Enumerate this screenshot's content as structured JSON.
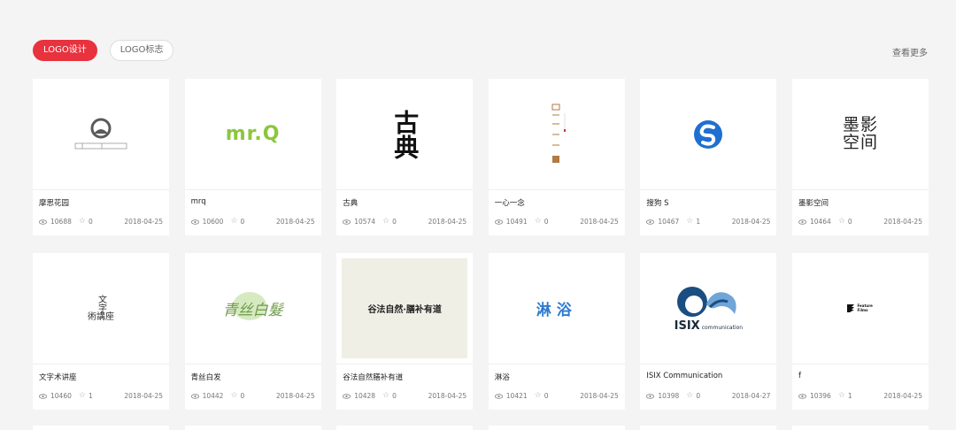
{
  "tabs": [
    {
      "label": "LOGO设计",
      "active": true
    },
    {
      "label": "LOGO标志",
      "active": false
    }
  ],
  "more_label": "查看更多",
  "items": [
    {
      "title": "摩思花园",
      "views": "10688",
      "stars": "0",
      "date": "2018-04-25",
      "logo_icon": "moso-garden-logo"
    },
    {
      "title": "mrq",
      "views": "10600",
      "stars": "0",
      "date": "2018-04-25",
      "logo_icon": "mrq-logo"
    },
    {
      "title": "古典",
      "views": "10574",
      "stars": "0",
      "date": "2018-04-25",
      "logo_icon": "classic-calligraphy-logo"
    },
    {
      "title": "一心一念",
      "views": "10491",
      "stars": "0",
      "date": "2018-04-25",
      "logo_icon": "one-heart-logo"
    },
    {
      "title": "搜狗 S",
      "views": "10467",
      "stars": "1",
      "date": "2018-04-25",
      "logo_icon": "sogou-s-logo"
    },
    {
      "title": "墨影空间",
      "views": "10464",
      "stars": "0",
      "date": "2018-04-25",
      "logo_icon": "ink-shadow-logo"
    },
    {
      "title": "文字术讲座",
      "views": "10460",
      "stars": "1",
      "date": "2018-04-25",
      "logo_icon": "typography-lecture-logo"
    },
    {
      "title": "青丝白发",
      "views": "10442",
      "stars": "0",
      "date": "2018-04-25",
      "logo_icon": "green-silk-logo"
    },
    {
      "title": "谷法自然膳补有道",
      "views": "10428",
      "stars": "0",
      "date": "2018-04-25",
      "logo_icon": "natural-diet-logo"
    },
    {
      "title": "淋浴",
      "views": "10421",
      "stars": "0",
      "date": "2018-04-25",
      "logo_icon": "shower-logo"
    },
    {
      "title": "ISIX Communication",
      "views": "10398",
      "stars": "0",
      "date": "2018-04-27",
      "logo_icon": "isix-logo"
    },
    {
      "title": "f",
      "views": "10396",
      "stars": "1",
      "date": "2018-04-25",
      "logo_icon": "feature-films-logo"
    }
  ],
  "logo_text": {
    "mrq": "mr.Q",
    "classic": "古典",
    "ink_top": "墨影",
    "ink_bottom": "空间",
    "typo_top": "文字",
    "typo_bottom": "術講座",
    "green": "青丝白髮",
    "natural": "谷法自然·膳补有道",
    "shower": "淋浴",
    "isix": "ISIX",
    "isix_sub": "communication",
    "feature": "Feature Films"
  },
  "colors": {
    "accent": "#e8323e",
    "mrq_green": "#8cc63e",
    "sogou_blue": "#1f6fd1",
    "isix_blue": "#1a4e80",
    "shower_blue": "#2f7bd0"
  }
}
